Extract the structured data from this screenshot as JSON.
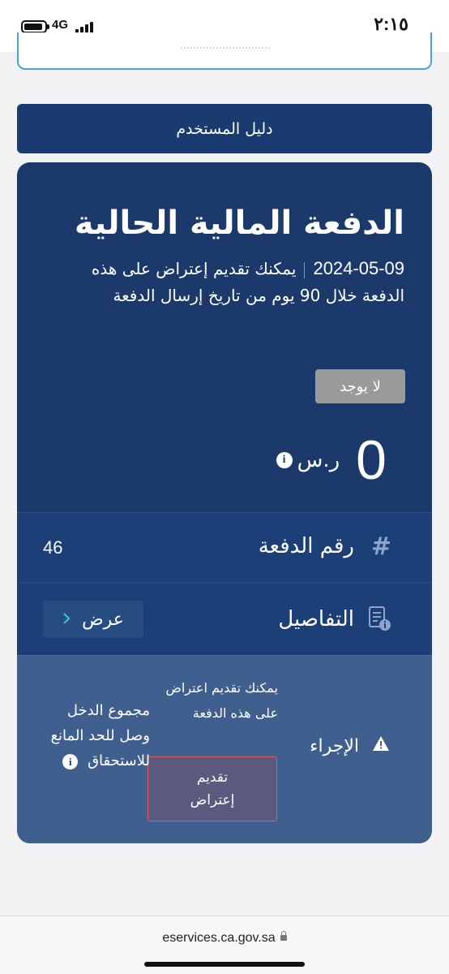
{
  "status_bar": {
    "time": "٢:١٥",
    "network": "4G",
    "battery_level": 0.8
  },
  "guide_button": {
    "label": "دليل المستخدم"
  },
  "payment_card": {
    "title": "الدفعة المالية الحالية",
    "date": "2024-05-09",
    "description": "يمكنك تقديم إعتراض على هذه الدفعة خلال 90 يوم من تاريخ إرسال الدفعة",
    "badge": "لا يوجد",
    "amount_value": "0",
    "amount_unit": "ر.س",
    "number_row": {
      "label": "رقم الدفعة",
      "value": "46"
    },
    "details_row": {
      "label": "التفاصيل",
      "button_label": "عرض"
    },
    "action_row": {
      "label": "الإجراء",
      "description": "يمكنك تقديم اعتراض على هذه الدفعة",
      "button_label": "تقديم إعتراض",
      "note": "مجموع الدخل وصل للحد المانع للاستحقاق"
    }
  },
  "browser": {
    "url": "eservices.ca.gov.sa"
  },
  "colors": {
    "card_background": "#1b3a6b",
    "action_background": "#3f5f8f",
    "badge_background": "#9a9a9a",
    "accent_teal": "#39c2c9",
    "alert_border": "#e05a5a"
  },
  "icons": {
    "info": "info-icon",
    "hash": "hash-icon",
    "details": "document-info-icon",
    "warning": "warning-icon",
    "chevron": "chevron-right-icon",
    "lock": "lock-icon"
  }
}
